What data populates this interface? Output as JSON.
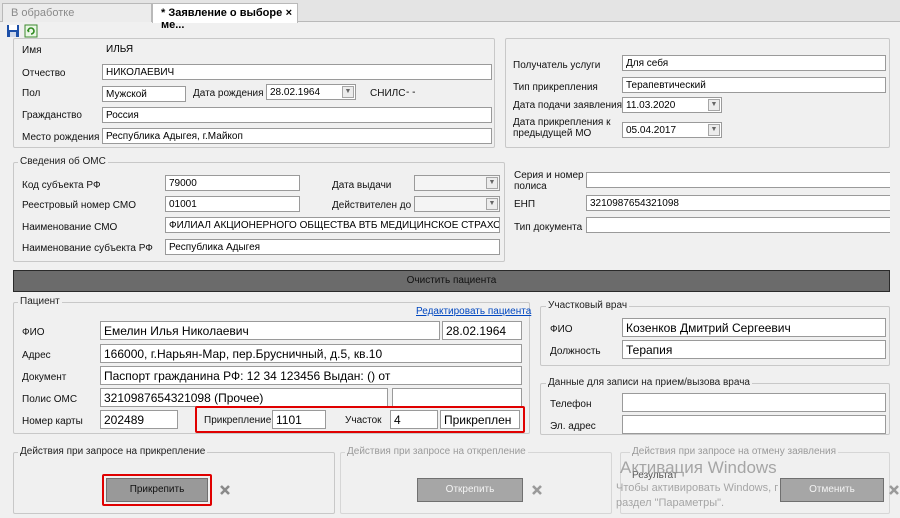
{
  "tabs": {
    "inactive": "В обработке",
    "active": "* Заявление о выборе ме...",
    "close": "×"
  },
  "toolbar": {
    "save_icon": "floppy-disk-icon",
    "refresh_icon": "refresh-icon"
  },
  "person": {
    "name_label": "Имя",
    "name_value": "ИЛЬЯ",
    "patronymic_label": "Отчество",
    "patronymic_value": "НИКОЛАЕВИЧ",
    "sex_label": "Пол",
    "sex_value": "Мужской",
    "dob_label": "Дата рождения",
    "dob_value": "28.02.1964",
    "snils_label": "СНИЛС",
    "snils_value": "  -  -",
    "citizenship_label": "Гражданство",
    "citizenship_value": "Россия",
    "birthplace_label": "Место рождения",
    "birthplace_value": "Республика Адыгея, г.Майкоп"
  },
  "service": {
    "recipient_label": "Получатель услуги",
    "recipient_value": "Для себя",
    "attach_type_label": "Тип прикрепления",
    "attach_type_value": "Терапевтический",
    "submit_date_label": "Дата подачи заявления",
    "submit_date_value": "11.03.2020",
    "prev_date_label": "Дата прикрепления к предыдущей МО",
    "prev_date_value": "05.04.2017"
  },
  "oms": {
    "title": "Сведения об ОМС",
    "subject_code_label": "Код субъекта РФ",
    "subject_code_value": "79000",
    "issue_date_label": "Дата выдачи",
    "registry_label": "Реестровый номер СМО",
    "registry_value": "01001",
    "valid_until_label": "Действителен до",
    "smo_name_label": "Наименование СМО",
    "smo_name_value": "ФИЛИАЛ АКЦИОНЕРНОГО ОБЩЕСТВА ВТБ МЕДИЦИНСКОЕ СТРАХОВАНИ",
    "subject_name_label": "Наименование субъекта РФ",
    "subject_name_value": "Республика Адыгея",
    "series_label": "Серия и номер полиса",
    "enp_label": "ЕНП",
    "enp_value": "3210987654321098",
    "doc_type_label": "Тип документа"
  },
  "clear_button": "Очистить пациента",
  "patient": {
    "title": "Пациент",
    "edit_link": "Редактировать пациента",
    "fio_label": "ФИО",
    "fio_value": "Емелин Илья Николаевич",
    "dob_value": "28.02.1964",
    "address_label": "Адрес",
    "address_value": "166000, г.Нарьян-Мар, пер.Брусничный, д.5, кв.10",
    "document_label": "Документ",
    "document_value": "Паспорт гражданина РФ: 12 34 123456 Выдан: () от",
    "policy_label": "Полис ОМС",
    "policy_value": "3210987654321098 (Прочее)",
    "card_label": "Номер карты",
    "card_value": "202489",
    "attach_label": "Прикрепление",
    "attach_value": "1101",
    "district_label": "Участок",
    "district_value": "4",
    "status_value": "Прикреплен"
  },
  "doctor": {
    "title": "Участковый врач",
    "fio_label": "ФИО",
    "fio_value": "Козенков Дмитрий Сергеевич",
    "position_label": "Должность",
    "position_value": "Терапия"
  },
  "appointment": {
    "title": "Данные для записи на прием/вызова врача",
    "phone_label": "Телефон",
    "email_label": "Эл. адрес"
  },
  "actions": {
    "attach_title": "Действия при запросе на прикрепление",
    "attach_button": "Прикрепить",
    "detach_title": "Действия при запросе на открепление",
    "detach_button": "Открепить",
    "cancel_title": "Действия при запросе на отмену заявления",
    "result_label": "Результат",
    "cancel_button": "Отменить",
    "delete_icon": "delete-x-icon"
  },
  "watermark": {
    "line1": "Активация Windows",
    "line2": "Чтобы активировать Windows, перейдите в",
    "line3": "раздел \"Параметры\"."
  },
  "colors": {
    "highlight": "#e00000",
    "link": "#0047c0",
    "clear_bar": "#6b6b6b"
  }
}
